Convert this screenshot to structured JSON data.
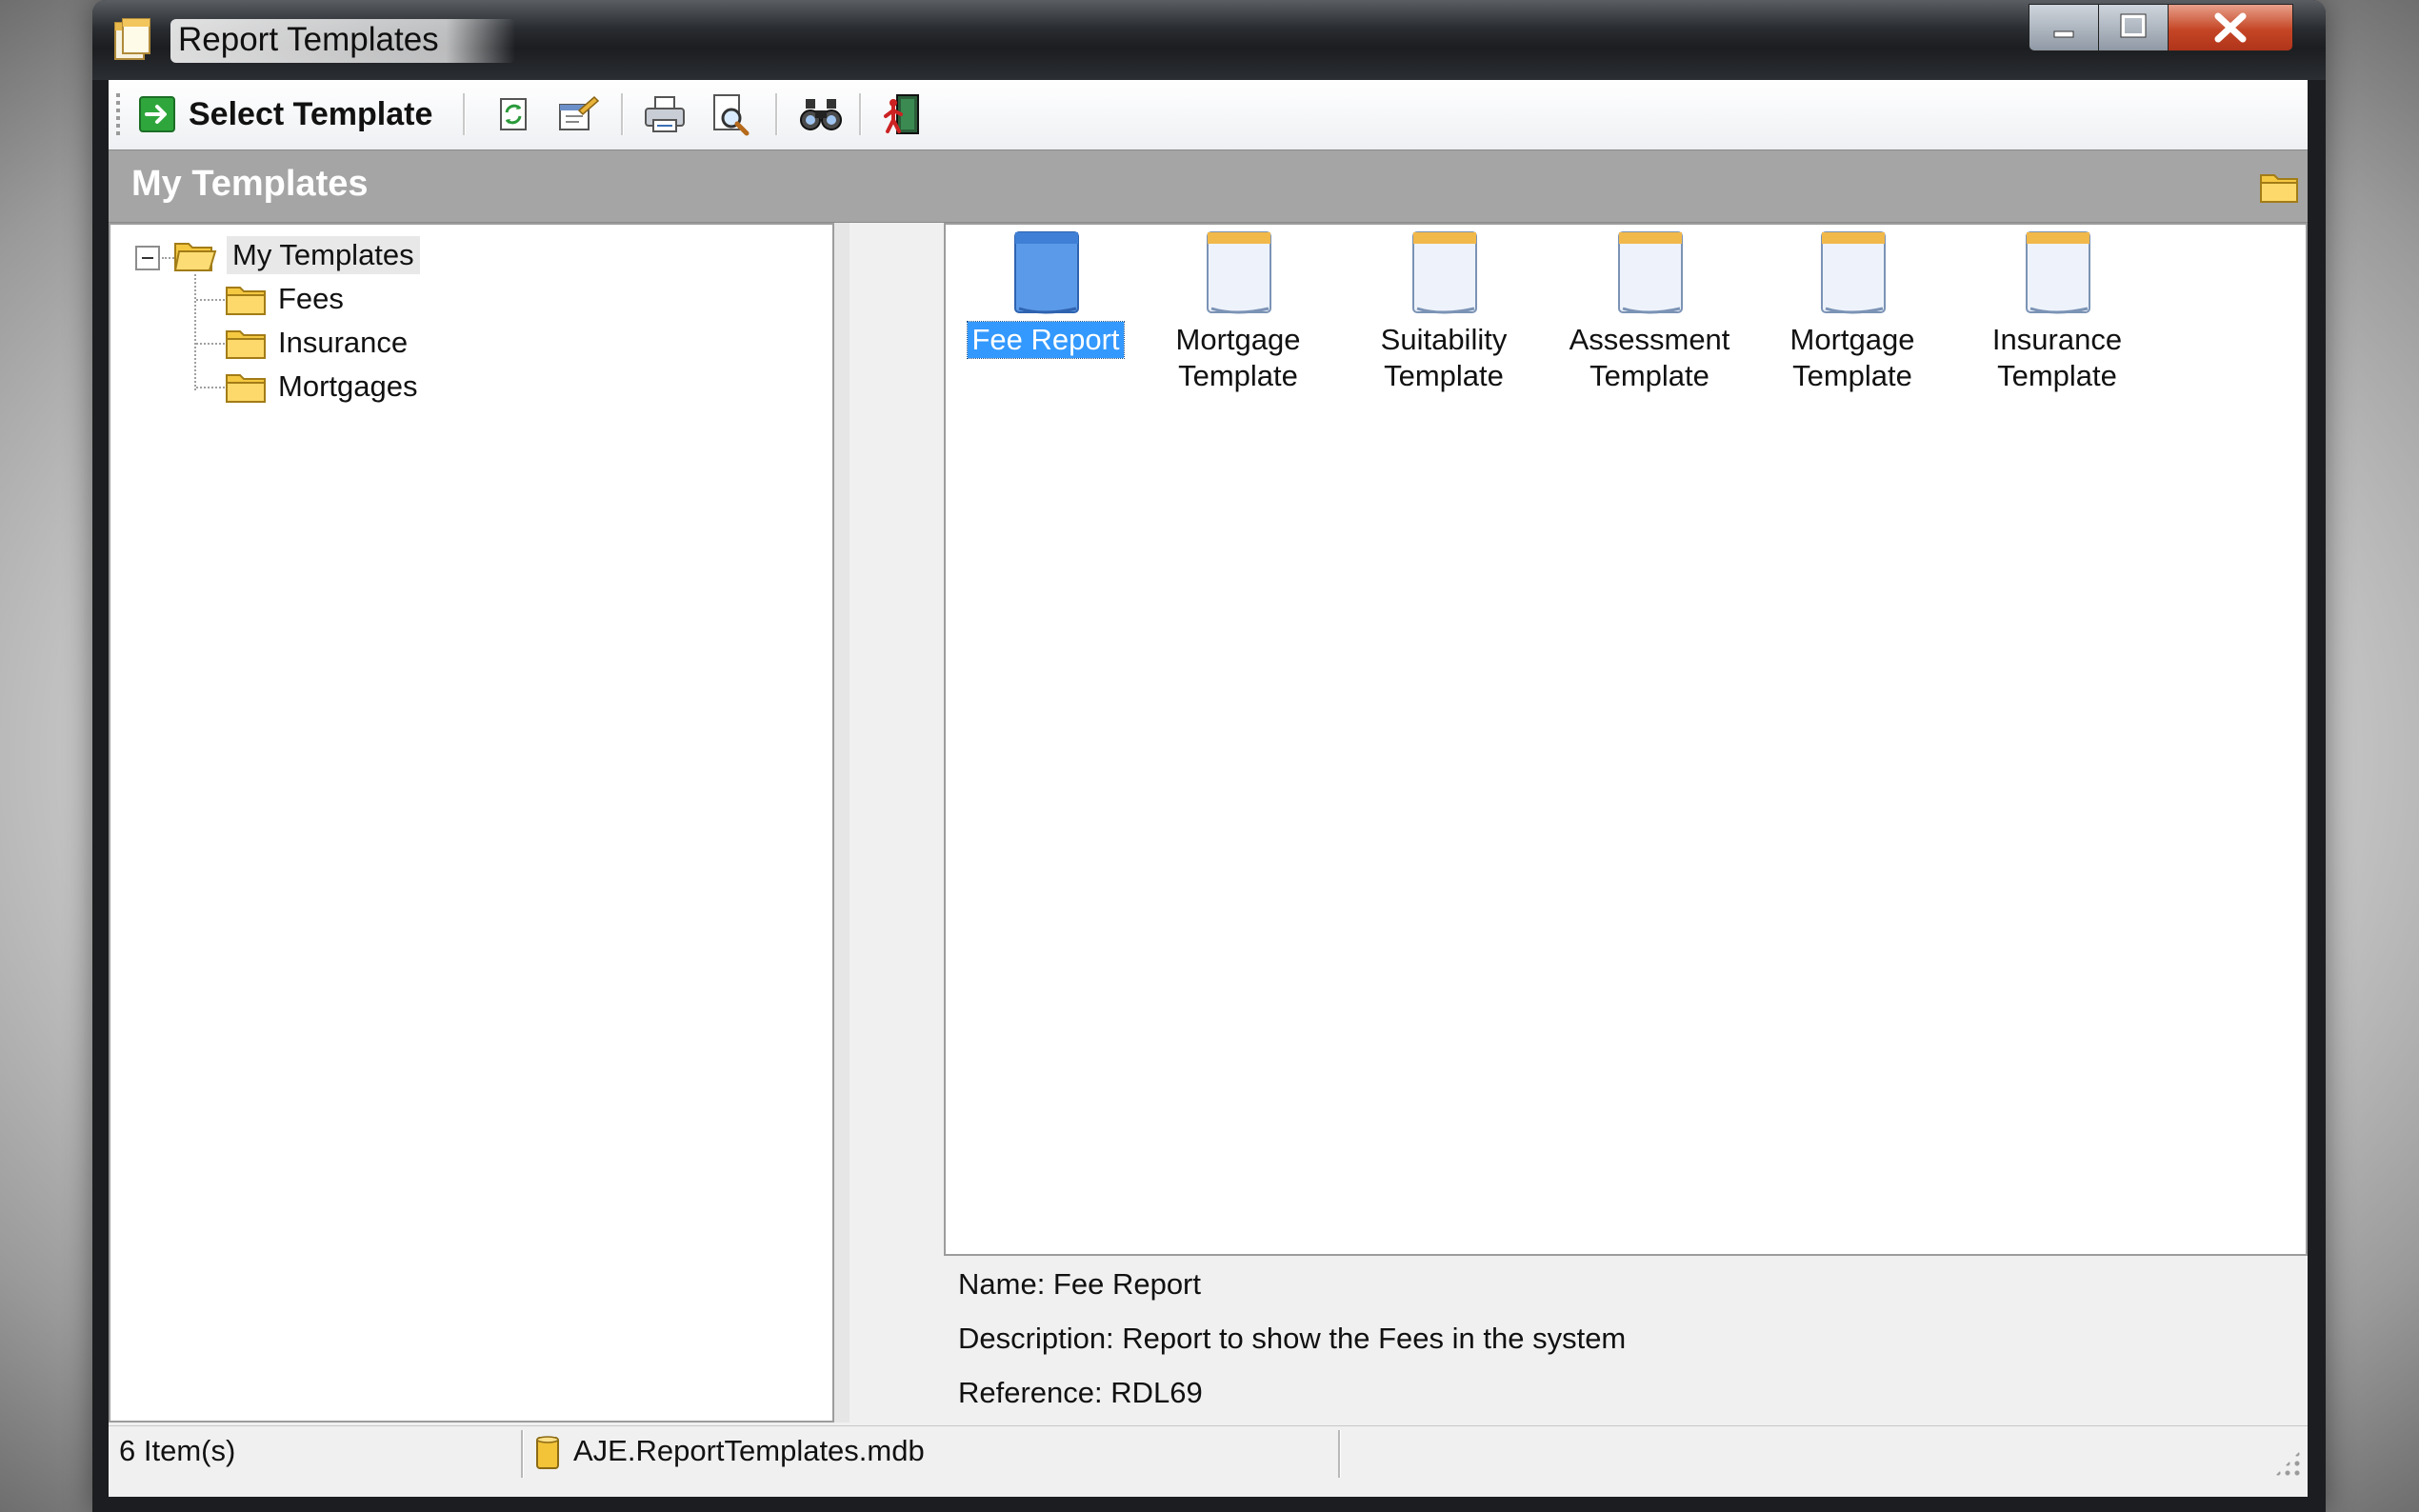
{
  "window": {
    "title": "Report Templates"
  },
  "toolbar": {
    "select_label": "Select Template",
    "buttons": [
      {
        "name": "refresh-icon"
      },
      {
        "name": "properties-icon"
      },
      {
        "name": "print-icon"
      },
      {
        "name": "print-preview-icon"
      },
      {
        "name": "find-icon"
      },
      {
        "name": "exit-icon"
      }
    ]
  },
  "header": {
    "title": "My Templates"
  },
  "tree": {
    "root": "My Templates",
    "children": [
      "Fees",
      "Insurance",
      "Mortgages"
    ]
  },
  "items": [
    {
      "line1": "Fee Report",
      "line2": ""
    },
    {
      "line1": "Mortgage",
      "line2": "Template"
    },
    {
      "line1": "Suitability",
      "line2": "Template"
    },
    {
      "line1": "Assessment",
      "line2": "Template"
    },
    {
      "line1": "Mortgage",
      "line2": "Template"
    },
    {
      "line1": "Insurance",
      "line2": "Template"
    }
  ],
  "details": {
    "name": "Name: Fee Report",
    "description": "Description: Report to show the Fees in the system",
    "reference": "Reference: RDL69"
  },
  "status": {
    "count": "6 Item(s)",
    "database": "AJE.ReportTemplates.mdb"
  },
  "colors": {
    "selection": "#3399ff",
    "header_bg": "#a5a5a5"
  }
}
